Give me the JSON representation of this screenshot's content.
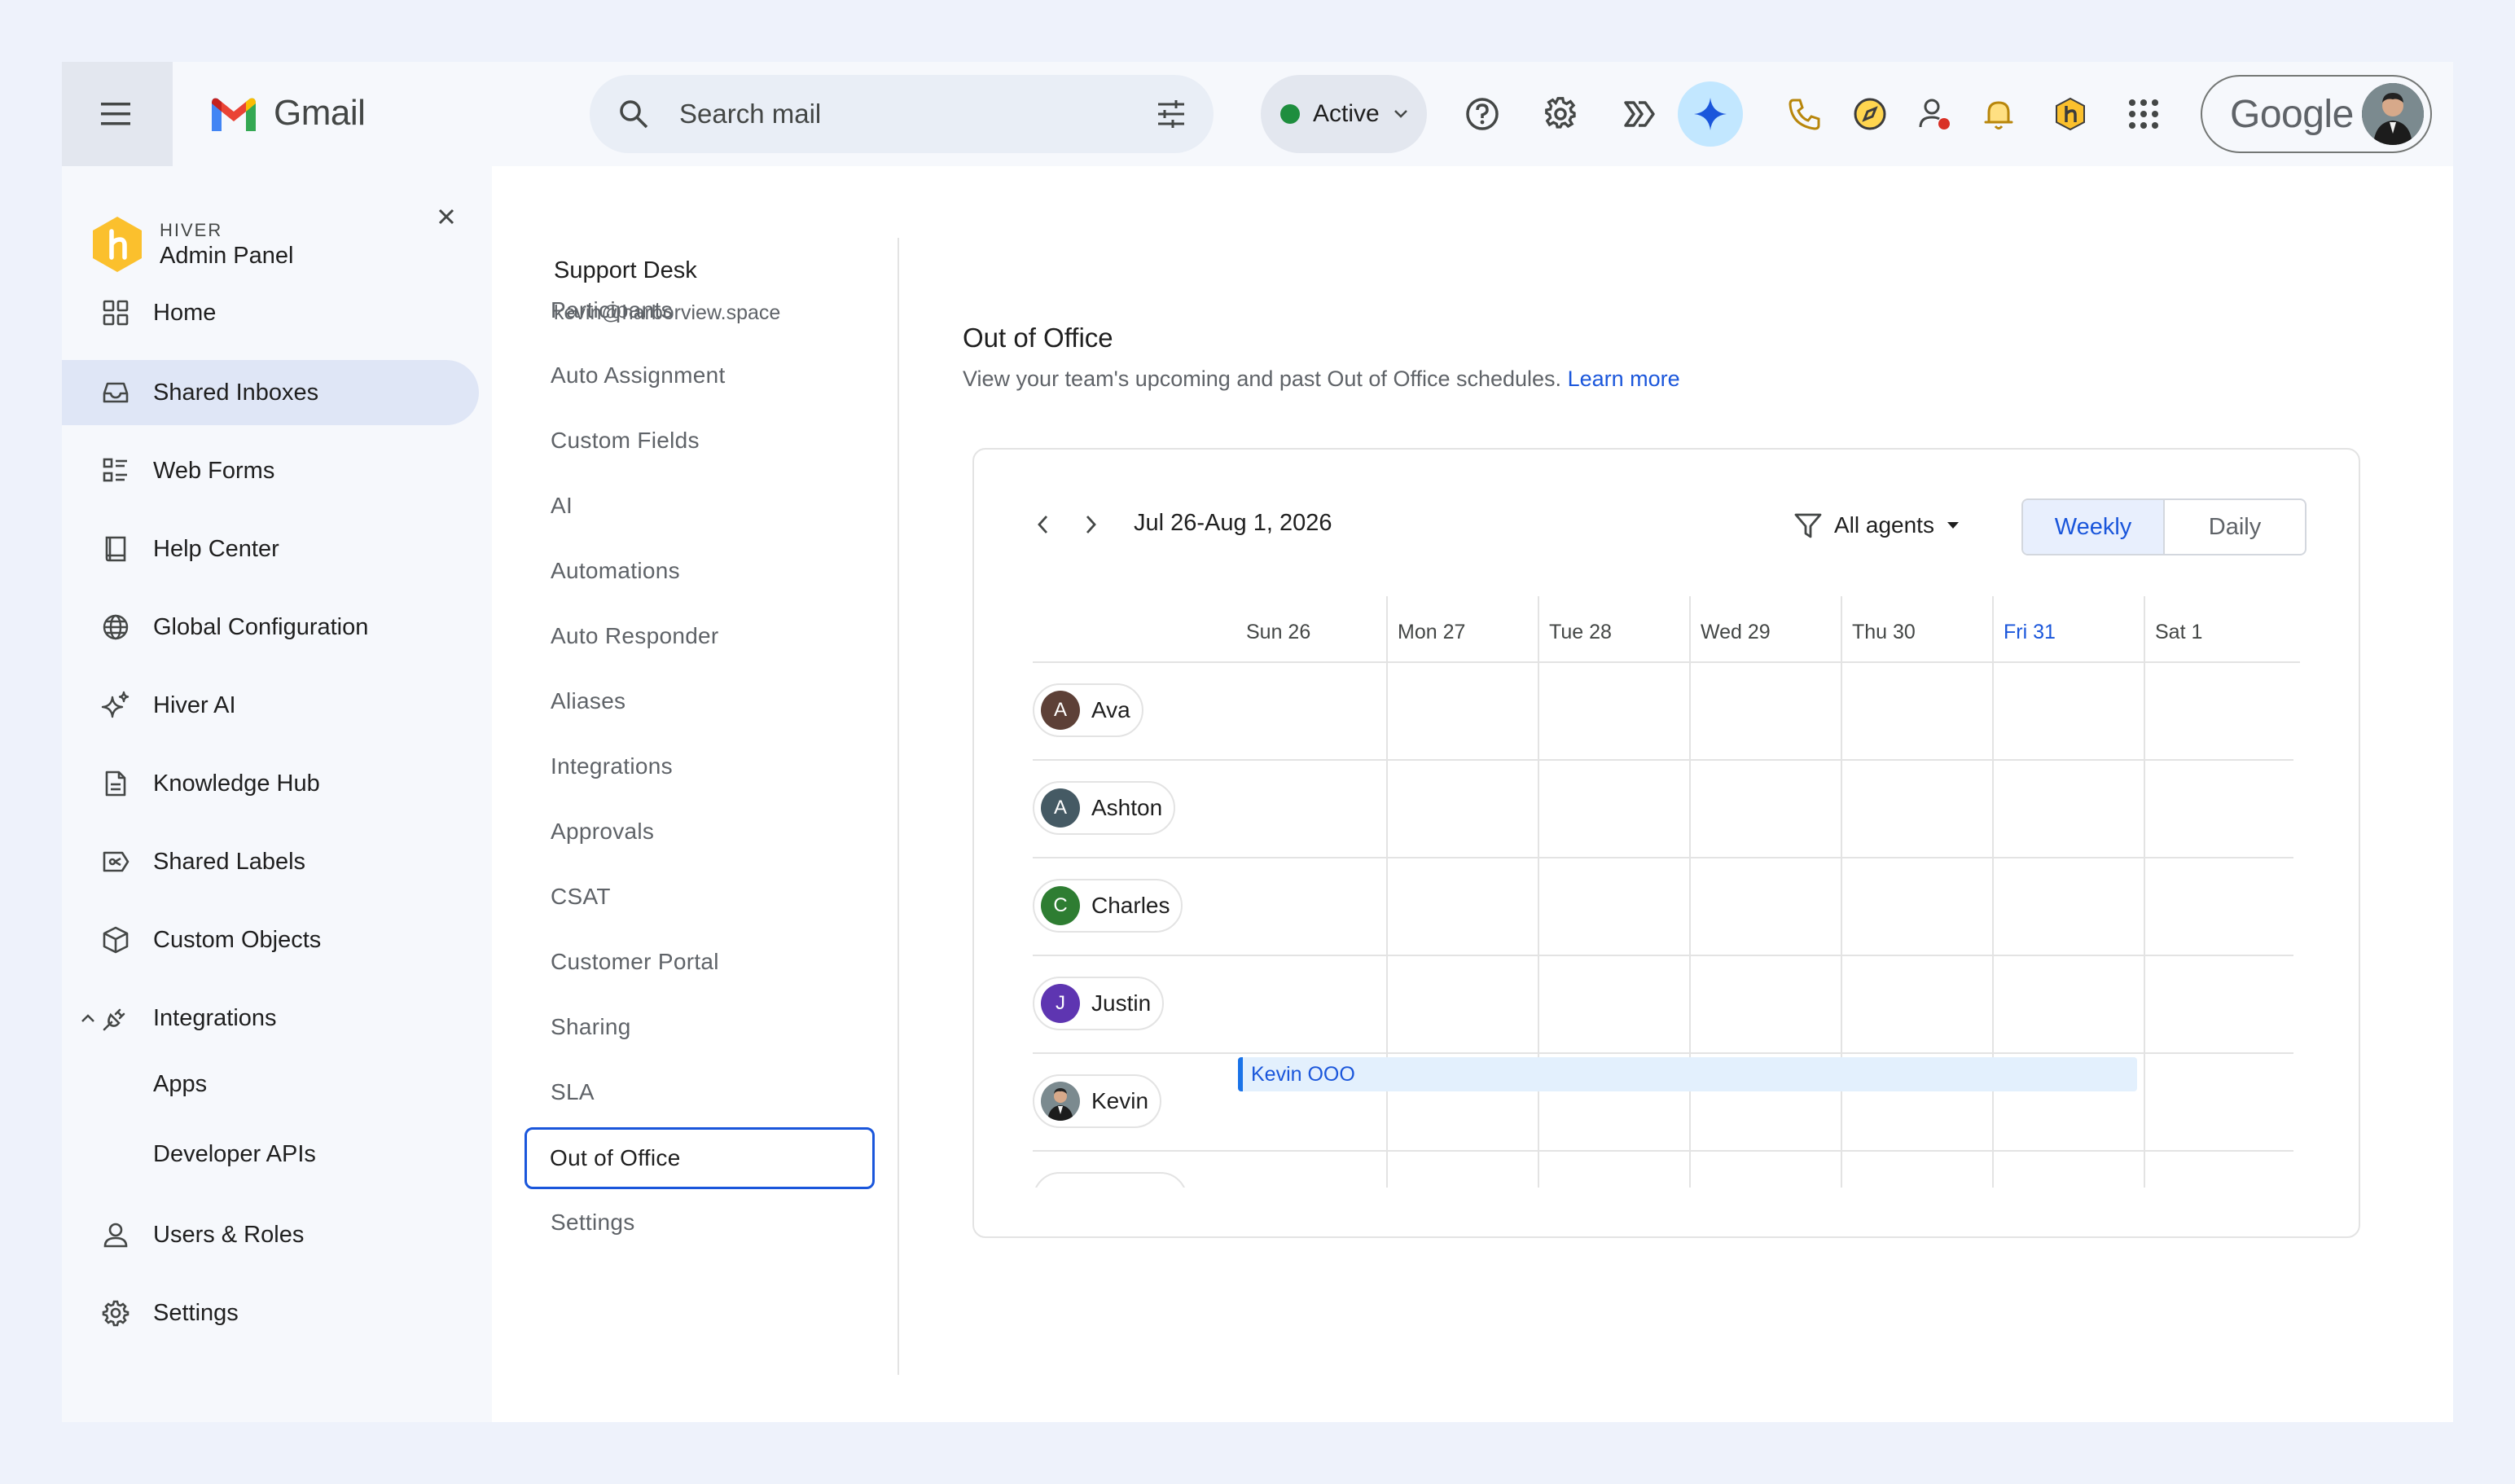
{
  "header": {
    "app_name": "Gmail",
    "search_placeholder": "Search mail",
    "status_label": "Active",
    "account_word": "Google"
  },
  "sidebar": {
    "brand_kicker": "HIVER",
    "brand_title": "Admin Panel",
    "items": [
      {
        "label": "Home",
        "icon": "home-grid-icon"
      },
      {
        "label": "Shared Inboxes",
        "icon": "inbox-icon",
        "active": true
      },
      {
        "label": "Web Forms",
        "icon": "forms-icon"
      },
      {
        "label": "Help Center",
        "icon": "book-icon"
      },
      {
        "label": "Global Configuration",
        "icon": "globe-icon"
      },
      {
        "label": "Hiver AI",
        "icon": "sparkle-icon"
      },
      {
        "label": "Knowledge Hub",
        "icon": "document-icon"
      },
      {
        "label": "Shared Labels",
        "icon": "label-icon"
      },
      {
        "label": "Custom Objects",
        "icon": "cube-icon"
      },
      {
        "label": "Integrations",
        "icon": "plug-icon",
        "expanded": true
      },
      {
        "label": "Apps",
        "sub": true
      },
      {
        "label": "Developer APIs",
        "sub": true
      },
      {
        "label": "Users & Roles",
        "icon": "person-icon"
      },
      {
        "label": "Settings",
        "icon": "gear-icon"
      }
    ]
  },
  "inbox": {
    "name": "Support Desk",
    "email": "kevin@harborview.space",
    "menu": [
      "Participants",
      "Auto Assignment",
      "Custom Fields",
      "AI",
      "Automations",
      "Auto Responder",
      "Aliases",
      "Integrations",
      "Approvals",
      "CSAT",
      "Customer Portal",
      "Sharing",
      "SLA",
      "Out of Office",
      "Settings"
    ],
    "selected": "Out of Office"
  },
  "content": {
    "title": "Out of Office",
    "description": "View your team's upcoming and past Out of Office schedules.",
    "learn_more": "Learn more"
  },
  "calendar": {
    "range": "Jul 26-Aug 1, 2026",
    "filter_label": "All agents",
    "view_options": [
      "Weekly",
      "Daily"
    ],
    "active_view": "Weekly",
    "days": [
      {
        "label": "Sun 26"
      },
      {
        "label": "Mon 27"
      },
      {
        "label": "Tue 28"
      },
      {
        "label": "Wed 29"
      },
      {
        "label": "Thu 30"
      },
      {
        "label": "Fri 31",
        "today": true
      },
      {
        "label": "Sat 1"
      }
    ],
    "agents": [
      {
        "name": "Ava",
        "initial": "A",
        "color": "#5d4037"
      },
      {
        "name": "Ashton",
        "initial": "A",
        "color": "#455a64"
      },
      {
        "name": "Charles",
        "initial": "C",
        "color": "#2e7d32"
      },
      {
        "name": "Justin",
        "initial": "J",
        "color": "#5e35b1"
      },
      {
        "name": "Kevin",
        "initial": "",
        "color": "#3c3c3c",
        "photo": true
      }
    ],
    "events": [
      {
        "label": "Kevin OOO",
        "agent": "Kevin",
        "start": "Sun 26",
        "end": "Fri 31"
      }
    ]
  },
  "colors": {
    "accent": "#1a56db",
    "status_green": "#1e8e3e",
    "gemini_bg": "#c2e7ff",
    "active_nav": "#dfe6f6"
  }
}
